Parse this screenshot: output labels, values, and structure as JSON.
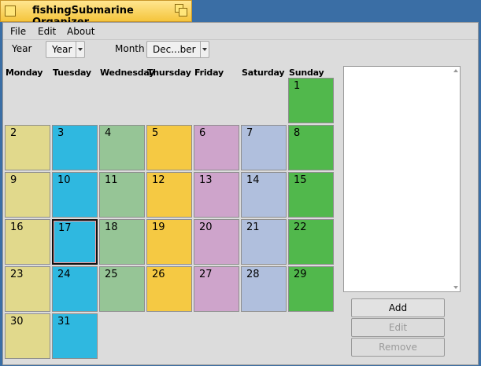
{
  "window": {
    "title": "fishingSubmarine Organizer"
  },
  "menu": [
    "File",
    "Edit",
    "About"
  ],
  "controls": {
    "year_label": "Year",
    "year_value": "Year",
    "month_label": "Month",
    "month_value": "Dec...ber"
  },
  "weekdays": [
    "Monday",
    "Tuesday",
    "Wednesday",
    "Thursday",
    "Friday",
    "Saturday",
    "Sunday"
  ],
  "calendar": {
    "first_weekday_index": 6,
    "days_in_month": 31,
    "selected_day": 17,
    "column_colors": [
      "#e1d98c",
      "#2fb8e0",
      "#96c596",
      "#f5c943",
      "#cea4cb",
      "#b0bfdd",
      "#51b84c"
    ]
  },
  "events_list": [],
  "buttons": {
    "add": "Add",
    "edit": "Edit",
    "remove": "Remove"
  }
}
